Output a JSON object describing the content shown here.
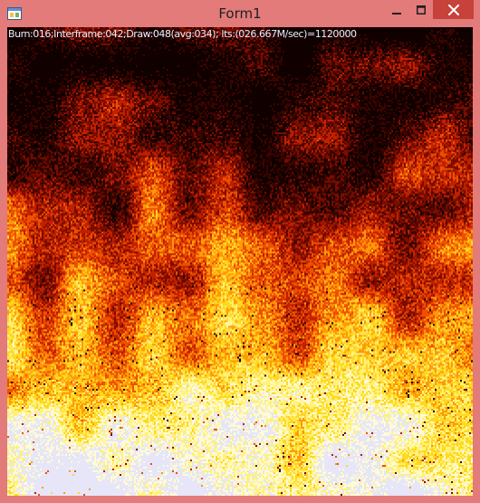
{
  "window": {
    "title": "Form1",
    "frame_color": "#e27b7a",
    "close_button_color": "#c7423a"
  },
  "titlebar": {
    "icon": "application-form-icon",
    "minimize_icon": "minimize-icon",
    "maximize_icon": "maximize-icon",
    "close_icon": "close-icon"
  },
  "overlay": {
    "stats_text": "Burn:016;Interframe:042;Draw:048(avg:034);  Its:(026.667M/sec)=1120000"
  },
  "fire_palette": [
    "#100000",
    "#3a0400",
    "#7a0c00",
    "#c02000",
    "#ee5000",
    "#ff9a0a",
    "#ffd820",
    "#fff27a",
    "#fffad6",
    "#e6e6f8"
  ]
}
